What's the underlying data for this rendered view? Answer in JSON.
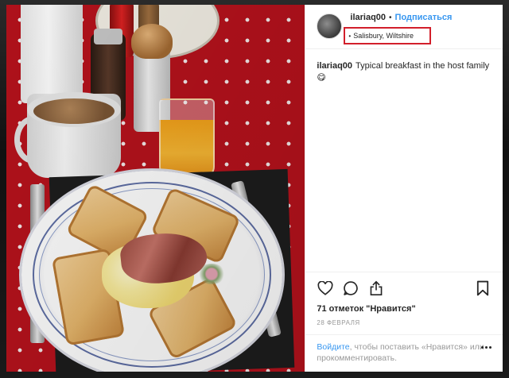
{
  "post": {
    "username": "ilariaq00",
    "dot": "•",
    "follow_label": "Подписаться",
    "location_bullet": "•",
    "location": "Salisbury, Wiltshire",
    "caption_user": "ilariaq00",
    "caption_text": "Typical breakfast in the host family😋",
    "likes": "71 отметок \"Нравится\"",
    "date": "28 ФЕВРАЛЯ",
    "login_link": "Войдите",
    "login_text": ", чтобы поставить «Нравится» или прокомментировать."
  },
  "colors": {
    "accent_blue": "#3897f0",
    "highlight_red": "#d21f2b",
    "text": "#262626",
    "muted": "#999999"
  },
  "icons": [
    "heart-icon",
    "comment-icon",
    "share-icon",
    "bookmark-icon",
    "more-icon"
  ]
}
